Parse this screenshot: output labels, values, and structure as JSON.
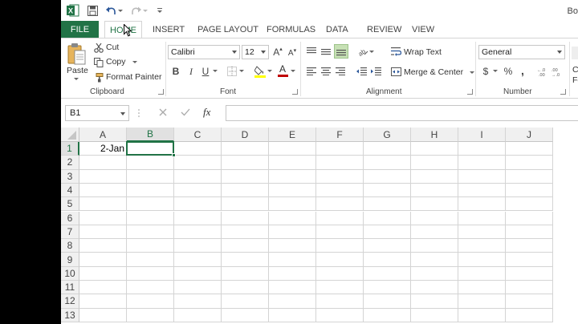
{
  "titlebar": {
    "app_icon": "excel-icon",
    "title_right": "Bo"
  },
  "tabs": [
    {
      "label": "FILE"
    },
    {
      "label": "HOME"
    },
    {
      "label": "INSERT"
    },
    {
      "label": "PAGE LAYOUT"
    },
    {
      "label": "FORMULAS"
    },
    {
      "label": "DATA"
    },
    {
      "label": "REVIEW"
    },
    {
      "label": "VIEW"
    }
  ],
  "ribbon": {
    "clipboard": {
      "label": "Clipboard",
      "paste": "Paste",
      "cut": "Cut",
      "copy": "Copy",
      "format_painter": "Format Painter"
    },
    "font": {
      "label": "Font",
      "font_name": "Calibri",
      "font_size": "12",
      "bold": "B",
      "italic": "I",
      "underline": "U",
      "font_color_letter": "A",
      "grow": "A",
      "shrink": "A"
    },
    "alignment": {
      "label": "Alignment",
      "wrap_text": "Wrap Text",
      "merge_center": "Merge & Center"
    },
    "number": {
      "label": "Number",
      "format": "General",
      "currency": "$",
      "percent": "%",
      "comma": ","
    },
    "partial_right": {
      "c": "C",
      "fo": "Fo"
    }
  },
  "formula_bar": {
    "name_box": "B1",
    "fx": "fx",
    "value": ""
  },
  "grid": {
    "columns": [
      "A",
      "B",
      "C",
      "D",
      "E",
      "F",
      "G",
      "H",
      "I",
      "J"
    ],
    "rows": [
      "1",
      "2",
      "3",
      "4",
      "5",
      "6",
      "7",
      "8",
      "9",
      "10",
      "11",
      "12",
      "13"
    ],
    "cells": {
      "A1": "2-Jan"
    },
    "active_cell": "B1"
  },
  "colors": {
    "accent": "#217346",
    "selected_alignment_bg": "#c6e0b4",
    "fill_highlight": "#ffff00",
    "font_color_bar": "#c00000"
  }
}
